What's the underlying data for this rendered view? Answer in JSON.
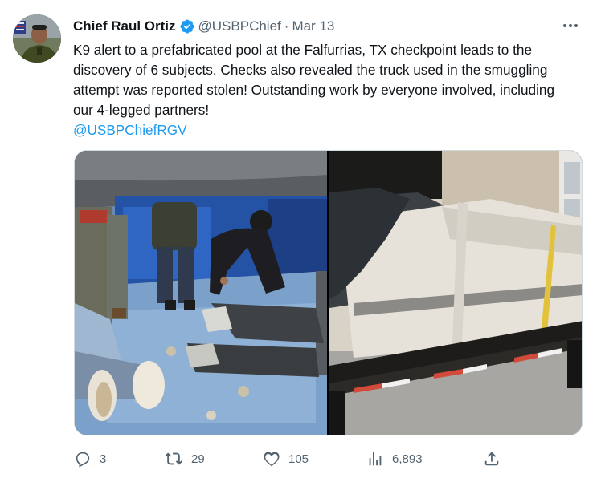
{
  "author": {
    "display_name": "Chief Raul Ortiz",
    "handle": "@USBPChief",
    "separator": "·",
    "date": "Mar 13",
    "avatar_icon": "profile-photo",
    "verified_icon": "verified-badge-icon"
  },
  "tweet": {
    "text": "K9 alert to a prefabricated pool at the Falfurrias, TX checkpoint leads to the discovery of 6 subjects. Checks also revealed the truck used in the smuggling attempt was reported stolen!  Outstanding work by everyone involved, including our 4-legged partners!",
    "mention": "@USBPChiefRGV"
  },
  "media": {
    "left_photo": "people-hidden-in-pool-photo",
    "right_photo": "flatbed-truck-with-pool-photo"
  },
  "actions": {
    "reply_count": "3",
    "retweet_count": "29",
    "like_count": "105",
    "views_count": "6,893"
  },
  "colors": {
    "accent": "#1d9bf0",
    "secondary_text": "#536471",
    "primary_text": "#0f1419"
  }
}
